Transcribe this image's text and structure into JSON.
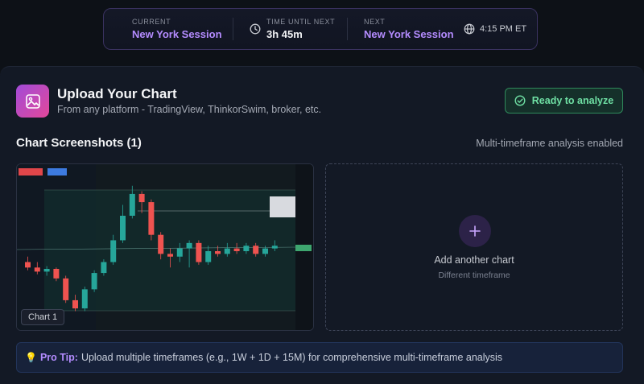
{
  "session": {
    "current_label": "CURRENT",
    "current_value": "New York Session",
    "time_label": "TIME UNTIL NEXT",
    "time_value": "3h 45m",
    "next_label": "NEXT",
    "next_value": "New York Session",
    "et_time": "4:15 PM ET"
  },
  "upload": {
    "title": "Upload Your Chart",
    "subtitle": "From any platform - TradingView, ThinkorSwim, broker, etc.",
    "ready_label": "Ready to analyze"
  },
  "screenshots": {
    "title": "Chart Screenshots (1)",
    "mtf_text": "Multi-timeframe analysis enabled",
    "items": [
      {
        "label": "Chart 1"
      }
    ],
    "add_title": "Add another chart",
    "add_sub": "Different timeframe"
  },
  "tip": {
    "label": "Pro Tip:",
    "text": "Upload multiple timeframes (e.g., 1W + 1D + 15M) for comprehensive multi-timeframe analysis"
  },
  "colors": {
    "accent_purple": "#b48cff",
    "ready_green": "#6fe0a4",
    "up_candle": "#26a69a",
    "down_candle": "#ef5350"
  },
  "icons": {
    "upload": "image-icon",
    "ready": "check-circle-icon",
    "time": "clock-icon",
    "tz": "globe-icon",
    "add": "plus-icon",
    "tip": "lightbulb-icon"
  },
  "thumb_candles": [
    [
      23620,
      23600,
      23640,
      23590
    ],
    [
      23600,
      23585,
      23620,
      23575
    ],
    [
      23585,
      23595,
      23605,
      23570
    ],
    [
      23595,
      23560,
      23600,
      23550
    ],
    [
      23560,
      23480,
      23570,
      23470
    ],
    [
      23480,
      23450,
      23500,
      23440
    ],
    [
      23450,
      23520,
      23530,
      23440
    ],
    [
      23520,
      23580,
      23590,
      23510
    ],
    [
      23580,
      23620,
      23630,
      23570
    ],
    [
      23620,
      23700,
      23720,
      23610
    ],
    [
      23700,
      23790,
      23830,
      23690
    ],
    [
      23790,
      23870,
      23900,
      23780
    ],
    [
      23870,
      23840,
      23880,
      23800
    ],
    [
      23840,
      23720,
      23850,
      23700
    ],
    [
      23720,
      23650,
      23730,
      23630
    ],
    [
      23650,
      23640,
      23670,
      23600
    ],
    [
      23640,
      23670,
      23690,
      23620
    ],
    [
      23670,
      23690,
      23700,
      23600
    ],
    [
      23690,
      23620,
      23700,
      23610
    ],
    [
      23620,
      23660,
      23680,
      23610
    ],
    [
      23660,
      23650,
      23680,
      23640
    ],
    [
      23650,
      23670,
      23690,
      23640
    ],
    [
      23670,
      23660,
      23690,
      23650
    ],
    [
      23660,
      23680,
      23690,
      23650
    ],
    [
      23680,
      23650,
      23690,
      23640
    ],
    [
      23650,
      23670,
      23680,
      23640
    ],
    [
      23670,
      23680,
      23700,
      23660
    ]
  ]
}
